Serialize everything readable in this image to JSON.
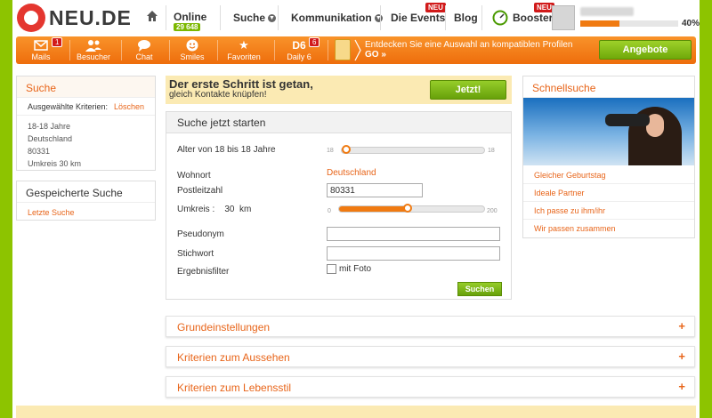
{
  "brand": {
    "name": "NEU.DE"
  },
  "nav": {
    "online_label": "Online",
    "online_count": "29 648",
    "suche": "Suche",
    "kommunikation": "Kommunikation",
    "events": "Die Events",
    "events_badge": "NEU",
    "blog": "Blog",
    "booster": "Booster",
    "booster_badge": "NEU"
  },
  "profile": {
    "progress_pct": 40,
    "progress_label": "40%"
  },
  "toolbar": {
    "items": [
      {
        "label": "Mails",
        "badge": "1"
      },
      {
        "label": "Besucher"
      },
      {
        "label": "Chat"
      },
      {
        "label": "Smiles"
      },
      {
        "label": "Favoriten"
      },
      {
        "label": "Daily 6",
        "icon_text": "D6",
        "badge": "6"
      }
    ],
    "promo_text": "Entdecken Sie eine Auswahl an kompatiblen Profilen",
    "promo_go": "GO »",
    "angebote": "Angebote"
  },
  "left": {
    "suche_title": "Suche",
    "criteria_label": "Ausgewählte Kriterien:",
    "clear": "Löschen",
    "criteria": [
      "18-18 Jahre",
      "Deutschland",
      "80331",
      "Umkreis 30 km"
    ],
    "saved_title": "Gespeicherte Suche",
    "last_search": "Letzte Suche"
  },
  "cta": {
    "line1": "Der erste Schritt ist getan,",
    "line2": "gleich Kontakte knüpfen!",
    "button": "Jetzt!"
  },
  "form": {
    "title": "Suche jetzt starten",
    "age_label": "Alter von 18 bis 18 Jahre",
    "age_min": "18",
    "age_max": "18",
    "age_fraction": 0.0,
    "wohnort_label": "Wohnort",
    "wohnort_value": "Deutschland",
    "plz_label": "Postleitzahl",
    "plz_value": "80331",
    "umkreis_label": "Umkreis :",
    "umkreis_value": "30",
    "umkreis_unit": "km",
    "umkreis_min": "0",
    "umkreis_max": "200",
    "umkreis_fraction": 0.48,
    "pseudonym_label": "Pseudonym",
    "pseudonym_value": "",
    "stichwort_label": "Stichwort",
    "stichwort_value": "",
    "filter_label": "Ergebnisfilter",
    "foto_label": "mit Foto",
    "search_button": "Suchen"
  },
  "accordions": [
    "Grundeinstellungen",
    "Kriterien zum Aussehen",
    "Kriterien zum Lebensstil"
  ],
  "accordion_toggle": "+",
  "right": {
    "title": "Schnellsuche",
    "links": [
      "Gleicher Geburtstag",
      "Ideale Partner",
      "Ich passe zu ihm/ihr",
      "Wir passen zusammen"
    ]
  },
  "colors": {
    "accent": "#f07a11",
    "green": "#7cb800",
    "frame": "#8dc400"
  }
}
